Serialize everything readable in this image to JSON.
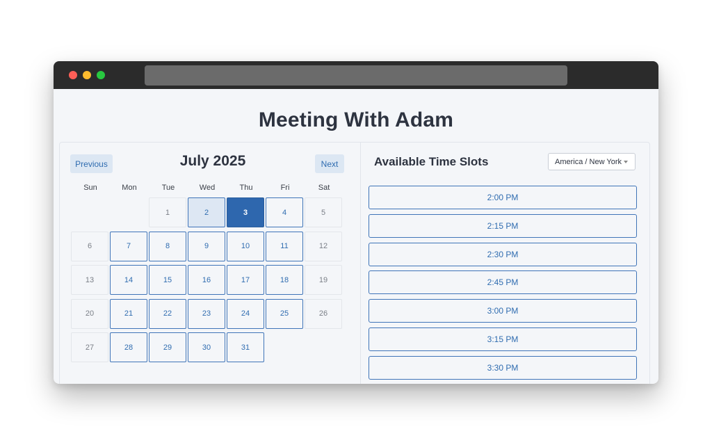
{
  "page": {
    "title": "Meeting With Adam"
  },
  "calendar": {
    "prev_label": "Previous",
    "next_label": "Next",
    "month_label": "July 2025",
    "weekdays": [
      "Sun",
      "Mon",
      "Tue",
      "Wed",
      "Thu",
      "Fri",
      "Sat"
    ],
    "days": [
      {
        "label": "1",
        "state": "disabled"
      },
      {
        "label": "2",
        "state": "highlight"
      },
      {
        "label": "3",
        "state": "selected"
      },
      {
        "label": "4",
        "state": "available"
      },
      {
        "label": "5",
        "state": "disabled"
      },
      {
        "label": "6",
        "state": "disabled"
      },
      {
        "label": "7",
        "state": "available"
      },
      {
        "label": "8",
        "state": "available"
      },
      {
        "label": "9",
        "state": "available"
      },
      {
        "label": "10",
        "state": "available"
      },
      {
        "label": "11",
        "state": "available"
      },
      {
        "label": "12",
        "state": "disabled"
      },
      {
        "label": "13",
        "state": "disabled"
      },
      {
        "label": "14",
        "state": "available"
      },
      {
        "label": "15",
        "state": "available"
      },
      {
        "label": "16",
        "state": "available"
      },
      {
        "label": "17",
        "state": "available"
      },
      {
        "label": "18",
        "state": "available"
      },
      {
        "label": "19",
        "state": "disabled"
      },
      {
        "label": "20",
        "state": "disabled"
      },
      {
        "label": "21",
        "state": "available"
      },
      {
        "label": "22",
        "state": "available"
      },
      {
        "label": "23",
        "state": "available"
      },
      {
        "label": "24",
        "state": "available"
      },
      {
        "label": "25",
        "state": "available"
      },
      {
        "label": "26",
        "state": "disabled"
      },
      {
        "label": "27",
        "state": "disabled"
      },
      {
        "label": "28",
        "state": "available"
      },
      {
        "label": "29",
        "state": "available"
      },
      {
        "label": "30",
        "state": "available"
      },
      {
        "label": "31",
        "state": "available"
      }
    ]
  },
  "slots": {
    "title": "Available Time Slots",
    "timezone": "America / New York",
    "times": [
      "2:00 PM",
      "2:15 PM",
      "2:30 PM",
      "2:45 PM",
      "3:00 PM",
      "3:15 PM",
      "3:30 PM"
    ]
  },
  "colors": {
    "accent": "#2e67ae",
    "accent_text": "#2f6cb0",
    "highlight_bg": "#dde7f3",
    "page_bg": "#f4f6f9",
    "titlebar": "#2b2b2b"
  }
}
